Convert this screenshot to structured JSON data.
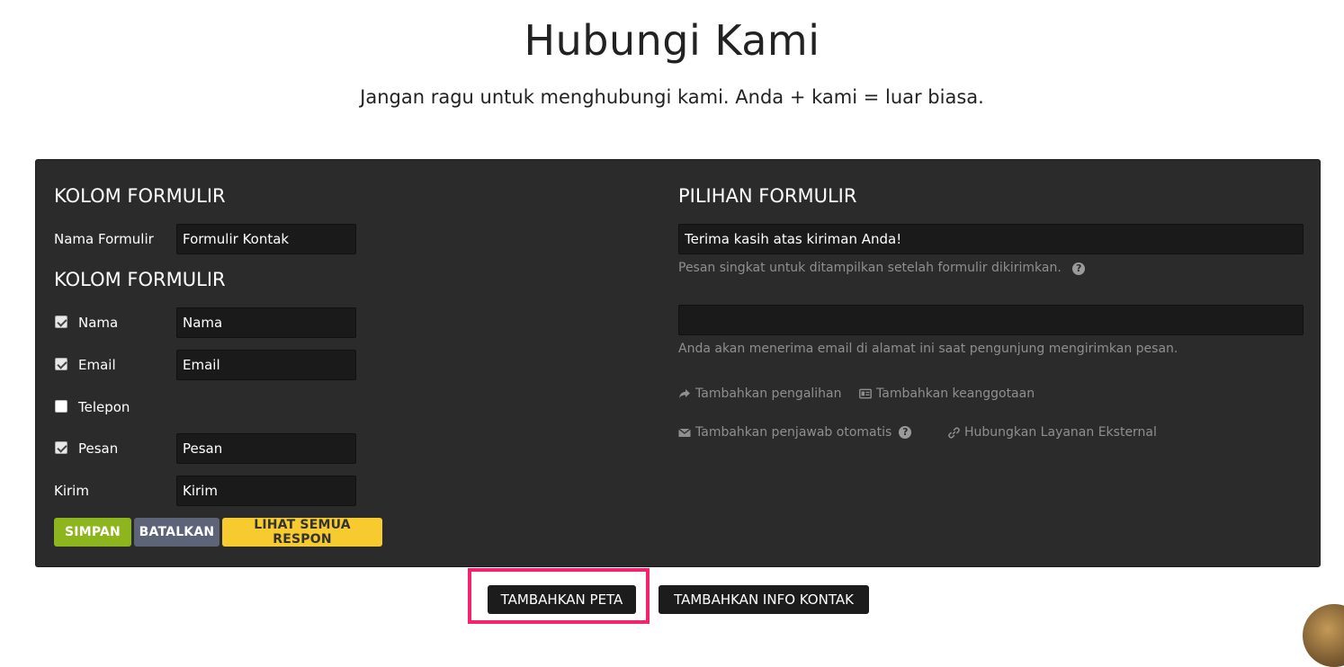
{
  "header": {
    "title": "Hubungi Kami",
    "subtitle": "Jangan ragu untuk menghubungi kami. Anda + kami = luar biasa."
  },
  "form_fields": {
    "section_title": "KOLOM FORMULIR",
    "form_name_label": "Nama Formulir",
    "form_name_value": "Formulir Kontak",
    "fields_section_title": "KOLOM FORMULIR",
    "fields": [
      {
        "label": "Nama",
        "checked": true,
        "value": "Nama"
      },
      {
        "label": "Email",
        "checked": true,
        "value": "Email"
      },
      {
        "label": "Telepon",
        "checked": false,
        "value": ""
      },
      {
        "label": "Pesan",
        "checked": true,
        "value": "Pesan"
      }
    ],
    "submit_label": "Kirim",
    "submit_value": "Kirim",
    "buttons": {
      "save": "SIMPAN",
      "cancel": "BATALKAN",
      "view_responses": "LIHAT SEMUA RESPON"
    }
  },
  "form_options": {
    "section_title": "PILIHAN FORMULIR",
    "thank_you_value": "Terima kasih atas kiriman Anda!",
    "thank_you_hint": "Pesan singkat untuk ditampilkan setelah formulir dikirimkan.",
    "email_value": "",
    "email_hint": "Anda akan menerima email di alamat ini saat pengunjung mengirimkan pesan.",
    "links": {
      "redirect": "Tambahkan pengalihan",
      "membership": "Tambahkan keanggotaan",
      "autoresponder": "Tambahkan penjawab otomatis",
      "external": "Hubungkan Layanan Eksternal"
    }
  },
  "bottom_actions": {
    "add_map": "TAMBAHKAN PETA",
    "add_contact_info": "TAMBAHKAN INFO KONTAK"
  },
  "colors": {
    "panel_bg": "#2b2b2b",
    "save": "#8cb51e",
    "cancel": "#5d6478",
    "responses": "#f7cb2f",
    "highlight": "#f5236f"
  }
}
